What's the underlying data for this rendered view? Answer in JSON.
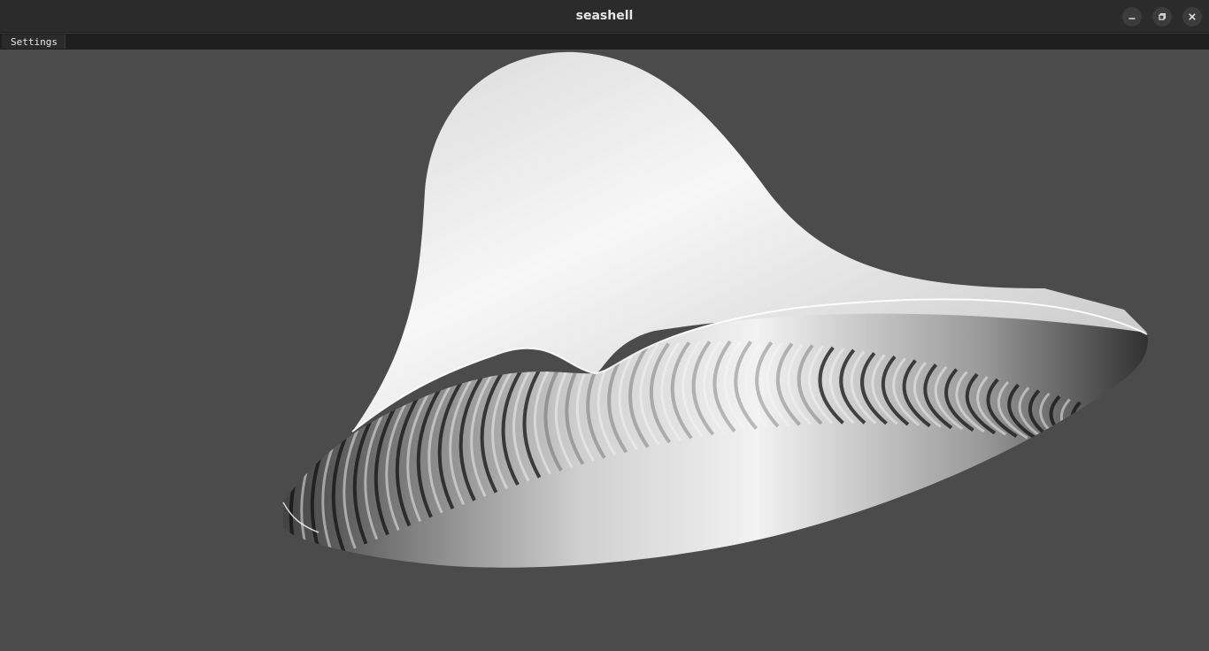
{
  "window": {
    "title": "seashell"
  },
  "menubar": {
    "items": [
      {
        "label": "Settings"
      }
    ]
  },
  "icons": {
    "minimize": "minimize-icon",
    "maximize": "restore-icon",
    "close": "close-icon"
  },
  "colors": {
    "titlebar": "#2b2b2b",
    "menubar": "#1e1e1e",
    "viewport_background": "#4b4b4b",
    "shell_light": "#f5f5f5",
    "shell_dark": "#111111"
  }
}
